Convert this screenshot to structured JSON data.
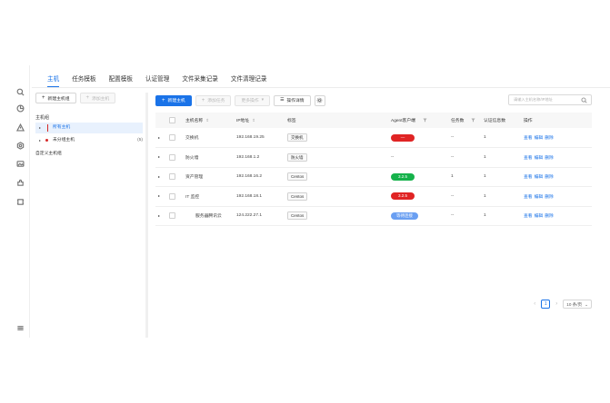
{
  "tabs": [
    {
      "label": "主机"
    },
    {
      "label": "任务模板"
    },
    {
      "label": "配置模板"
    },
    {
      "label": "认证管理"
    },
    {
      "label": "文件采集记录"
    },
    {
      "label": "文件清理记录"
    }
  ],
  "sidebar_icons": [
    "search-icon",
    "pie-chart-icon",
    "warning-icon",
    "settings-icon",
    "image-icon",
    "puzzle-icon",
    "frame-icon",
    "menu-icon"
  ],
  "group_panel": {
    "new_group_button": "新建主机组",
    "add_host_button": "添加主机",
    "group_title": "主机组",
    "items": [
      {
        "label": "所有主机",
        "count": ""
      },
      {
        "label": "未分组主机",
        "count": "(5)"
      }
    ],
    "custom_group_title": "自定义主机组"
  },
  "toolbar": {
    "new_host": "新建主机",
    "add_task": "添加任务",
    "more_ops": "更多操作",
    "op_details": "操作详情",
    "search_placeholder": "请输入主机名称/IP地址"
  },
  "table": {
    "headers": {
      "name": "主机名称",
      "ip": "IP地址",
      "tag": "标签",
      "agent": "Agent客户端",
      "tasks": "任务数",
      "certs": "认证信息数",
      "ops": "操作"
    },
    "rows": [
      {
        "name": "交换机",
        "ip": "192.168.19.25",
        "tag": "交换机",
        "agent": "—",
        "agent_color": "red",
        "tasks": "--",
        "certs": "1"
      },
      {
        "name": "防火墙",
        "ip": "192.168.1.2",
        "tag": "防火墙",
        "agent": "--",
        "agent_color": "",
        "tasks": "--",
        "certs": "1"
      },
      {
        "name": "资产管理",
        "ip": "192.168.16.2",
        "tag": "Centos",
        "agent": "3.2.5",
        "agent_color": "green",
        "tasks": "1",
        "certs": "1"
      },
      {
        "name": "IT 监控",
        "ip": "192.168.18.1",
        "tag": "Centos",
        "agent": "3.2.5",
        "agent_color": "red",
        "tasks": "--",
        "certs": "1"
      },
      {
        "name": "服务器腾讯云",
        "ip": "124.222.27.1",
        "tag": "Centos",
        "agent": "等待连接",
        "agent_color": "blue",
        "tasks": "--",
        "certs": "1"
      }
    ],
    "ops": [
      "查看",
      "编辑",
      "删除"
    ]
  },
  "pager": {
    "prev": "‹",
    "current": "1",
    "next": "›",
    "size": "10 条/页"
  },
  "colors": {
    "accent": "#1a73e8",
    "danger": "#e02424",
    "success": "#16b24b",
    "info": "#6a9ff2"
  }
}
